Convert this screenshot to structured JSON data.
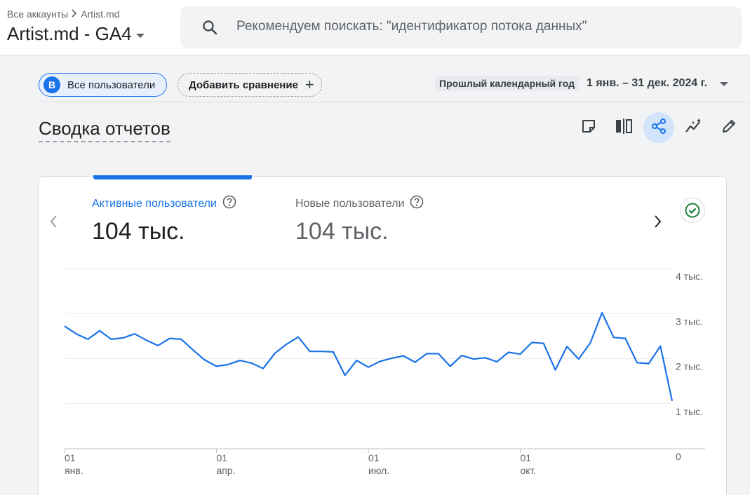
{
  "breadcrumb": {
    "all_accounts": "Все аккаунты",
    "separator": ">",
    "account": "Artist.md"
  },
  "property": {
    "name": "Artist.md - GA4"
  },
  "search": {
    "placeholder": "Рекомендуем поискать: \"идентификатор потока данных\""
  },
  "segment": {
    "letter": "B",
    "label": "Все пользователи"
  },
  "comparison": {
    "label": "Добавить сравнение"
  },
  "date_range": {
    "preset": "Прошлый календарный год",
    "range": "1 янв. – 31 дек. 2024 г."
  },
  "page": {
    "title": "Сводка отчетов"
  },
  "toolbar": [
    "note-icon",
    "compare-icon",
    "share-icon",
    "insights-icon",
    "edit-icon"
  ],
  "colors": {
    "accent": "#1a73e8",
    "line": "#1a73e8",
    "success": "#188038"
  },
  "metrics": [
    {
      "label": "Активные пользователи",
      "value": "104 тыс."
    },
    {
      "label": "Новые пользователи",
      "value": "104 тыс."
    }
  ],
  "chart_data": {
    "type": "line",
    "series": [
      {
        "values": [
          2720,
          2550,
          2430,
          2620,
          2430,
          2460,
          2550,
          2410,
          2290,
          2450,
          2430,
          2190,
          1970,
          1830,
          1870,
          1960,
          1900,
          1780,
          2120,
          2320,
          2480,
          2160,
          2160,
          2150,
          1630,
          1960,
          1810,
          1940,
          2010,
          2060,
          1920,
          2110,
          2110,
          1830,
          2070,
          1990,
          2020,
          1930,
          2140,
          2100,
          2360,
          2340,
          1750,
          2270,
          1990,
          2350,
          3020,
          2470,
          2450,
          1910,
          1890,
          2280,
          1060
        ]
      }
    ],
    "ylim": [
      0,
      4000
    ],
    "y_ticks": [
      "4 тыс.",
      "3 тыс.",
      "2 тыс.",
      "1 тыс.",
      "0"
    ],
    "x_ticks": [
      {
        "day": "01",
        "month": "янв."
      },
      {
        "day": "01",
        "month": "апр."
      },
      {
        "day": "01",
        "month": "июл."
      },
      {
        "day": "01",
        "month": "окт."
      }
    ],
    "grid": true
  }
}
